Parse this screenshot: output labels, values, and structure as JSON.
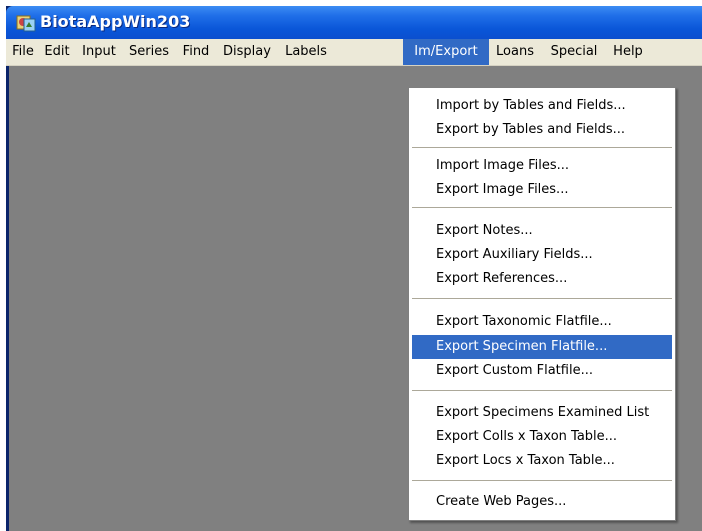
{
  "window": {
    "title": "BiotaAppWin203"
  },
  "menubar": {
    "items": [
      {
        "label": "File"
      },
      {
        "label": "Edit"
      },
      {
        "label": "Input"
      },
      {
        "label": "Series"
      },
      {
        "label": "Find"
      },
      {
        "label": "Display"
      },
      {
        "label": "Labels"
      },
      {
        "label": "Im/Export",
        "active": true
      },
      {
        "label": "Loans"
      },
      {
        "label": "Special"
      },
      {
        "label": "Help"
      }
    ]
  },
  "dropdown": {
    "groups": [
      [
        "Import by Tables and Fields...",
        "Export by Tables and Fields..."
      ],
      [
        "Import Image Files...",
        "Export Image Files..."
      ],
      [
        "Export Notes...",
        "Export Auxiliary Fields...",
        "Export References..."
      ],
      [
        "Export Taxonomic Flatfile...",
        "Export Specimen Flatfile...",
        "Export Custom Flatfile..."
      ],
      [
        "Export Specimens Examined List",
        "Export Colls x Taxon Table...",
        "Export Locs x Taxon Table..."
      ],
      [
        "Create Web Pages..."
      ]
    ],
    "highlighted": "Export Specimen Flatfile..."
  },
  "colors": {
    "title_bar": "#0a56d8",
    "menu_bar": "#ece9d8",
    "highlight": "#316ac5",
    "client_area": "#808080"
  },
  "icons": {
    "app": "app-icon"
  }
}
